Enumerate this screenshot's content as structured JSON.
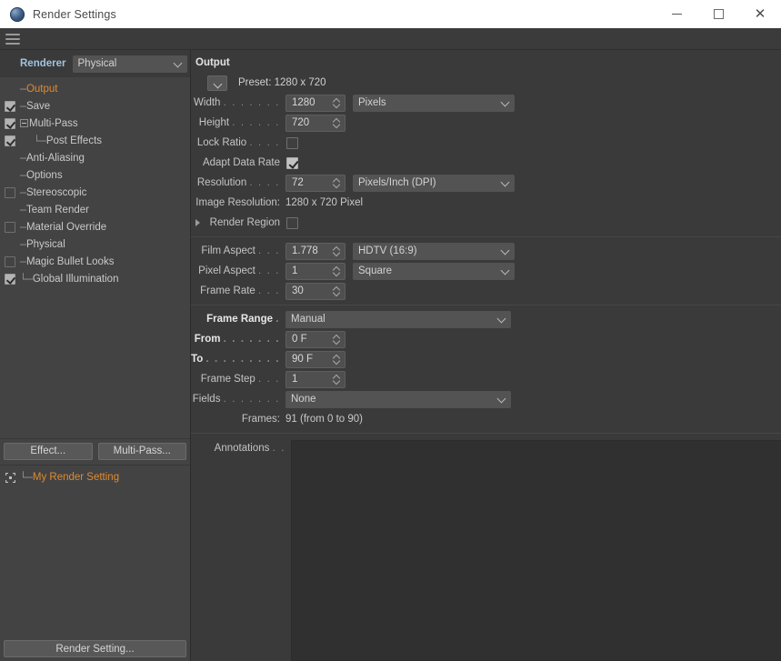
{
  "window": {
    "title": "Render Settings",
    "app_icon": "c4d-sphere-icon",
    "minimize_label": "minimize",
    "maximize_label": "maximize",
    "close_label": "close",
    "menu_icon": "hamburger-menu-icon"
  },
  "sidebar": {
    "renderer": {
      "label": "Renderer",
      "value": "Physical"
    },
    "tree": [
      {
        "label": "Output",
        "checkbox": null,
        "selected": true,
        "indent": 0,
        "branch": "─",
        "expander": false
      },
      {
        "label": "Save",
        "checkbox": true,
        "selected": false,
        "indent": 0,
        "branch": "─",
        "expander": false
      },
      {
        "label": "Multi-Pass",
        "checkbox": true,
        "selected": false,
        "indent": 0,
        "branch": "",
        "expander": true
      },
      {
        "label": "Post Effects",
        "checkbox": true,
        "selected": false,
        "indent": 1,
        "branch": "└─",
        "expander": false
      },
      {
        "label": "Anti-Aliasing",
        "checkbox": null,
        "selected": false,
        "indent": 0,
        "branch": "─",
        "expander": false
      },
      {
        "label": "Options",
        "checkbox": null,
        "selected": false,
        "indent": 0,
        "branch": "─",
        "expander": false
      },
      {
        "label": "Stereoscopic",
        "checkbox": false,
        "selected": false,
        "indent": 0,
        "branch": "─",
        "expander": false
      },
      {
        "label": "Team Render",
        "checkbox": null,
        "selected": false,
        "indent": 0,
        "branch": "─",
        "expander": false
      },
      {
        "label": "Material Override",
        "checkbox": false,
        "selected": false,
        "indent": 0,
        "branch": "─",
        "expander": false
      },
      {
        "label": "Physical",
        "checkbox": null,
        "selected": false,
        "indent": 0,
        "branch": "─",
        "expander": false
      },
      {
        "label": "Magic Bullet Looks",
        "checkbox": false,
        "selected": false,
        "indent": 0,
        "branch": "─",
        "expander": false
      },
      {
        "label": "Global Illumination",
        "checkbox": true,
        "selected": false,
        "indent": 0,
        "branch": "└─",
        "expander": false
      }
    ],
    "buttons": {
      "effect": "Effect...",
      "multipass": "Multi-Pass..."
    },
    "render_setting_item": {
      "label": "My Render Setting",
      "icon": "render-target-icon",
      "branch": "└─"
    },
    "footer_button": "Render Setting..."
  },
  "output": {
    "title": "Output",
    "preset": {
      "button_icon": "chevron-down-icon",
      "label": "Preset: 1280 x 720"
    },
    "width": {
      "label": "Width",
      "dots": ". . . . . . .",
      "value": "1280",
      "unit": "Pixels"
    },
    "height": {
      "label": "Height",
      "dots": ". . . . . .",
      "value": "720"
    },
    "lock_ratio": {
      "label": "Lock Ratio",
      "dots": ". . . .",
      "checked": false
    },
    "adapt_data_rate": {
      "label": "Adapt Data Rate",
      "dots": "",
      "checked": true
    },
    "resolution": {
      "label": "Resolution",
      "dots": ". . . .",
      "value": "72",
      "unit": "Pixels/Inch (DPI)"
    },
    "image_resolution": {
      "label": "Image Resolution:",
      "value": "1280 x 720 Pixel"
    },
    "render_region": {
      "label": "Render Region",
      "dots": "",
      "checked": false,
      "expander_icon": "chevron-right-icon"
    },
    "film_aspect": {
      "label": "Film Aspect",
      "dots": ". . .",
      "value": "1.778",
      "preset": "HDTV (16:9)"
    },
    "pixel_aspect": {
      "label": "Pixel Aspect",
      "dots": ". . .",
      "value": "1",
      "preset": "Square"
    },
    "frame_rate": {
      "label": "Frame Rate",
      "dots": ". . .",
      "value": "30"
    },
    "frame_range": {
      "label": "Frame Range",
      "dots": ".",
      "value": "Manual"
    },
    "from": {
      "label": "From",
      "dots": ". . . . . . .",
      "value": "0 F"
    },
    "to": {
      "label": "To",
      "dots": ". . . . . . . . .",
      "value": "90 F"
    },
    "frame_step": {
      "label": "Frame Step",
      "dots": ". . .",
      "value": "1"
    },
    "fields": {
      "label": "Fields",
      "dots": ". . . . . . .",
      "value": "None"
    },
    "frames": {
      "label": "Frames:",
      "value": "91 (from 0 to 90)"
    },
    "annotations": {
      "label": "Annotations",
      "dots": ". .",
      "value": ""
    }
  },
  "colors": {
    "accent_orange": "#e08a2e",
    "accent_blue": "#9fc4e0",
    "panel_bg": "#3a3a3a",
    "sidebar_bg": "#434343",
    "field_bg": "#4f4f4f",
    "select_bg": "#535353"
  }
}
